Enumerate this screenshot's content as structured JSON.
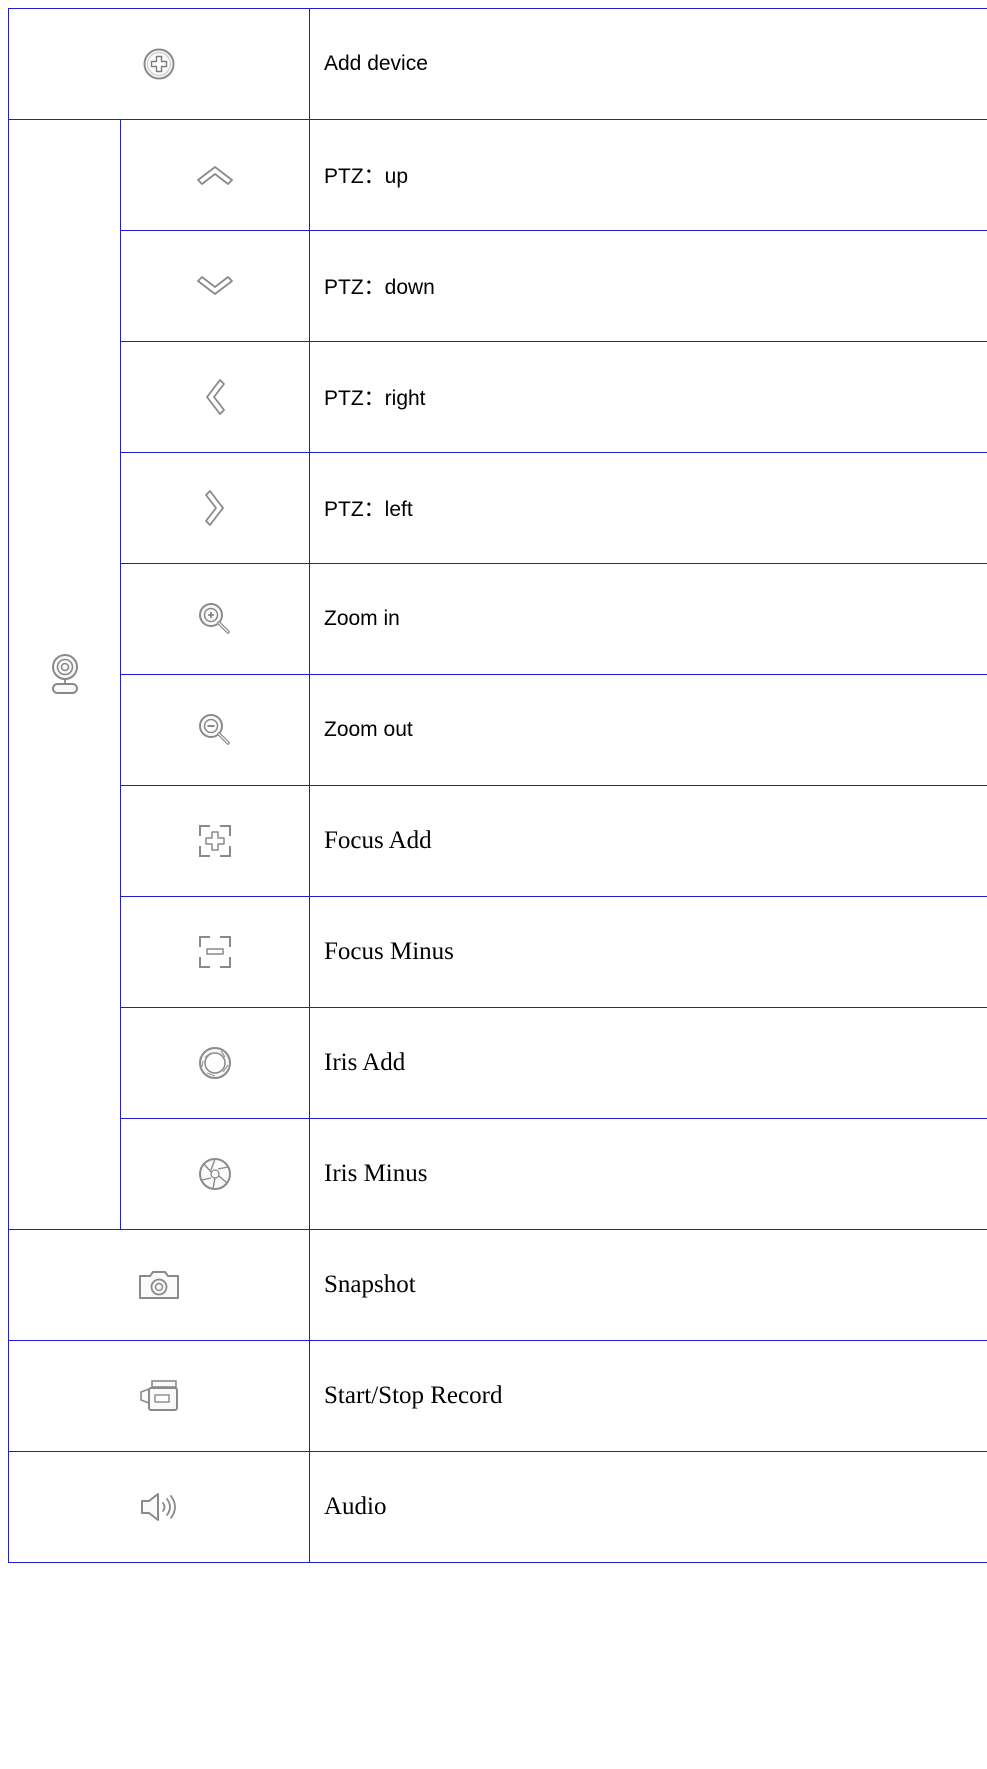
{
  "rows": [
    {
      "icon": "add-circle-icon",
      "label": "Add device"
    },
    {
      "icon": "chevron-up-icon",
      "label": "PTZ：up"
    },
    {
      "icon": "chevron-down-icon",
      "label": "PTZ：down"
    },
    {
      "icon": "chevron-left-icon",
      "label": "PTZ：right"
    },
    {
      "icon": "chevron-right-icon",
      "label": "PTZ：left"
    },
    {
      "icon": "zoom-in-icon",
      "label": "Zoom in"
    },
    {
      "icon": "zoom-out-icon",
      "label": "Zoom out"
    },
    {
      "icon": "focus-add-icon",
      "label": "Focus Add"
    },
    {
      "icon": "focus-minus-icon",
      "label": "Focus Minus"
    },
    {
      "icon": "iris-add-icon",
      "label": "Iris Add"
    },
    {
      "icon": "iris-minus-icon",
      "label": "Iris Minus"
    },
    {
      "icon": "camera-snapshot-icon",
      "label": "Snapshot"
    },
    {
      "icon": "video-record-icon",
      "label": "Start/Stop Record"
    },
    {
      "icon": "speaker-audio-icon",
      "label": "Audio"
    }
  ],
  "group_icon": "webcam-icon",
  "colors": {
    "border": "#1f1fcf",
    "icon_stroke": "#8a8a8a"
  }
}
